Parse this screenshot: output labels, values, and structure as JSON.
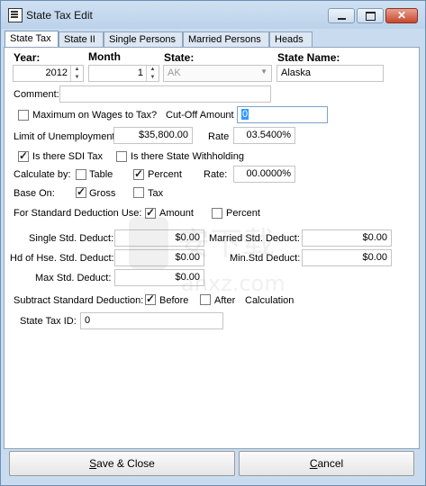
{
  "window": {
    "title": "State Tax Edit"
  },
  "tabs": [
    "State Tax",
    "State II",
    "Single Persons",
    "Married Persons",
    "Heads"
  ],
  "header": {
    "year_label": "Year:",
    "year_value": "2012",
    "month_label": "Month",
    "month_value": "1",
    "state_label": "State:",
    "state_value": "AK",
    "state_name_label": "State Name:",
    "state_name_value": "Alaska"
  },
  "comment": {
    "label": "Comment:",
    "value": ""
  },
  "max_wages": {
    "label": "Maximum on Wages to Tax?",
    "checked": false,
    "cutoff_label": "Cut-Off Amount",
    "cutoff_value": "0"
  },
  "unemployment": {
    "label": "Limit of Unemployment",
    "value": "$35,800.00",
    "rate_label": "Rate",
    "rate_value": "03.5400%"
  },
  "sdi": {
    "label": "Is there SDI Tax",
    "checked": true,
    "withholding_label": "Is there State Withholding",
    "withholding_checked": false
  },
  "calculate_by": {
    "label": "Calculate by:",
    "table_label": "Table",
    "table_checked": false,
    "percent_label": "Percent",
    "percent_checked": true,
    "rate_label": "Rate:",
    "rate_value": "00.0000%"
  },
  "base_on": {
    "label": "Base On:",
    "gross_label": "Gross",
    "gross_checked": true,
    "tax_label": "Tax",
    "tax_checked": false
  },
  "std_deduction": {
    "label": "For Standard Deduction Use:",
    "amount_label": "Amount",
    "amount_checked": true,
    "percent_label": "Percent",
    "percent_checked": false
  },
  "deductions": {
    "single_label": "Single Std. Deduct:",
    "single_value": "$0.00",
    "married_label": "Married Std. Deduct:",
    "married_value": "$0.00",
    "hoh_label": "Hd of Hse. Std. Deduct:",
    "hoh_value": "$0.00",
    "min_label": "Min.Std Deduct:",
    "min_value": "$0.00",
    "max_label": "Max Std. Deduct:",
    "max_value": "$0.00"
  },
  "subtract": {
    "label": "Subtract Standard Deduction:",
    "before_label": "Before",
    "before_checked": true,
    "after_label": "After",
    "after_checked": false,
    "calc_label": "Calculation"
  },
  "state_tax_id": {
    "label": "State Tax ID:",
    "value": "0"
  },
  "buttons": {
    "save_label": "Save & Close",
    "cancel_label": "Cancel"
  },
  "watermark": {
    "text": "anxz.com",
    "chinese": "安下载"
  }
}
